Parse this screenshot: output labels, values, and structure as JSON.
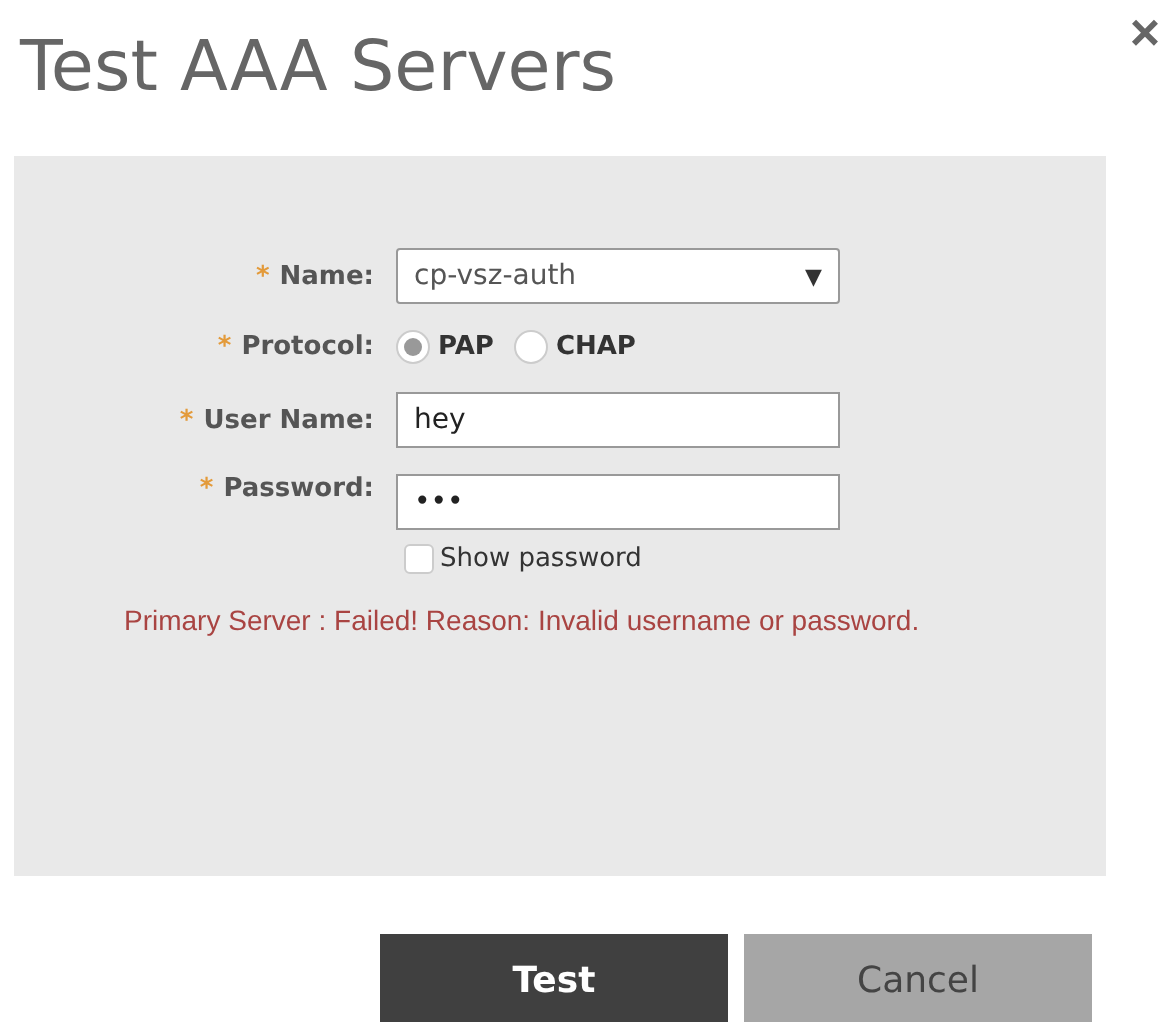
{
  "title": "Test AAA Servers",
  "close": "×",
  "fields": [
    {
      "kind": "select",
      "marker": "*",
      "label": "Name:",
      "value": "cp-vsz-auth",
      "caret": "▼"
    },
    {
      "kind": "radio",
      "marker": "*",
      "label": "Protocol:",
      "options": [
        {
          "label": "PAP",
          "selected": true
        },
        {
          "label": "CHAP",
          "selected": false
        }
      ]
    },
    {
      "kind": "text",
      "marker": "*",
      "label": "User Name:",
      "value": "hey"
    },
    {
      "kind": "text",
      "marker": "*",
      "label": "Password:",
      "value": "•••",
      "checkbox": {
        "label": "Show password",
        "checked": false
      }
    }
  ],
  "error": "Primary Server : Failed! Reason: Invalid username or password.",
  "buttons": [
    {
      "label": "Test",
      "kind": "primary"
    },
    {
      "label": "Cancel",
      "kind": "secondary"
    }
  ]
}
